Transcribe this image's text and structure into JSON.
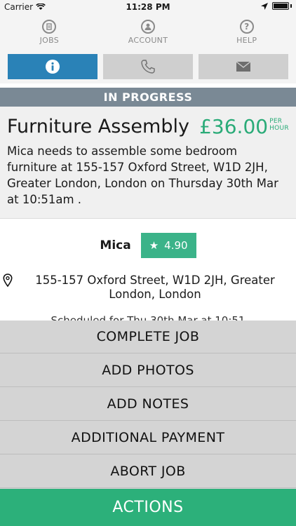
{
  "status_bar": {
    "carrier": "Carrier",
    "time": "11:28 PM"
  },
  "nav": {
    "items": [
      {
        "label": "JOBS",
        "icon": "jobs-icon"
      },
      {
        "label": "ACCOUNT",
        "icon": "account-icon"
      },
      {
        "label": "HELP",
        "icon": "help-icon"
      }
    ]
  },
  "segments": [
    {
      "icon": "info-icon",
      "active": true
    },
    {
      "icon": "phone-icon",
      "active": false
    },
    {
      "icon": "envelope-icon",
      "active": false
    }
  ],
  "job": {
    "status": "IN PROGRESS",
    "title": "Furniture Assembly",
    "price": "£36.00",
    "price_unit_top": "PER",
    "price_unit_bottom": "HOUR",
    "description": "Mica needs to assemble some bedroom furniture at 155-157 Oxford Street, W1D 2JH, Greater London, London on Thursday 30th Mar at 10:51am ."
  },
  "worker": {
    "name": "Mica",
    "rating": "4.90"
  },
  "address": "155-157 Oxford Street, W1D 2JH, Greater London, London",
  "schedule_text": "Scheduled for Thu 30th Mar at 10:51",
  "actions": {
    "complete": "COMPLETE JOB",
    "photos": "ADD PHOTOS",
    "notes": "ADD NOTES",
    "payment": "ADDITIONAL PAYMENT",
    "abort": "ABORT JOB",
    "footer": "ACTIONS"
  },
  "colors": {
    "accent_blue": "#2a82b7",
    "accent_green": "#2cb07a",
    "status_band": "#7a8995"
  }
}
